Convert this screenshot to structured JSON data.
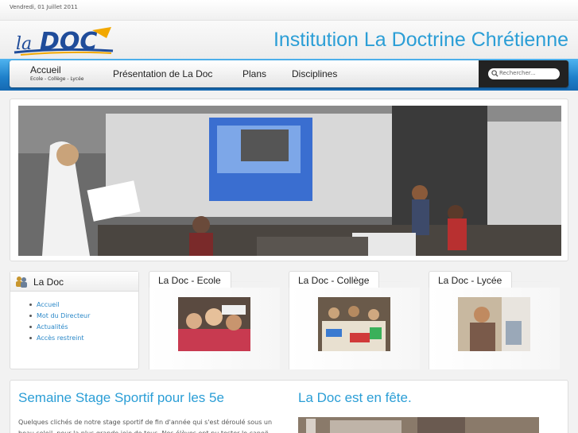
{
  "topbar": {
    "date": "Vendredi, 01 Juillet 2011"
  },
  "header": {
    "logo_text_la": "la",
    "logo_text_doc": "DOC",
    "title": "Institution La Doctrine Chrétienne"
  },
  "nav": {
    "home_label": "Accueil",
    "home_sub": "Ecole - Collège - Lycée",
    "items": [
      "Présentation de La Doc",
      "Plans",
      "Disciplines"
    ],
    "search_placeholder": "Rechercher..."
  },
  "sidebar": {
    "title": "La Doc",
    "items": [
      "Accueil",
      "Mot du Directeur",
      "Actualités",
      "Accès restreint"
    ]
  },
  "tabs": [
    {
      "label": "La Doc - Ecole"
    },
    {
      "label": "La Doc - Collège"
    },
    {
      "label": "La Doc - Lycée"
    }
  ],
  "articles": {
    "left_title": "Semaine Stage Sportif pour les 5e",
    "left_text": "Quelques clichés de notre stage sportif de fin d'année qui s'est déroulé sous un beau soleil, pour la plus grande joie de tous. Nos élèves ont pu tester le canoë",
    "right_title": "La Doc est en fête."
  },
  "colors": {
    "accent": "#2b9ed6",
    "nav_bar": "#1e7fc9",
    "link": "#2b88c8"
  }
}
